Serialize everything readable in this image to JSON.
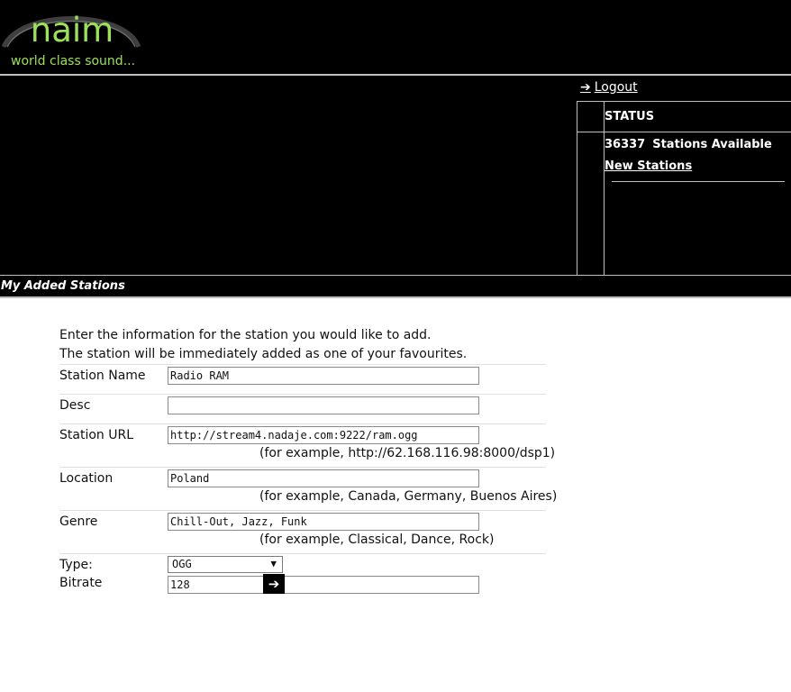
{
  "header": {
    "logo_text": "naim",
    "tagline": "world class sound..."
  },
  "nav": {
    "logout_label": "Logout",
    "logout_icon": "arrow-right-icon"
  },
  "status": {
    "title": "STATUS",
    "station_count": "36337",
    "station_count_suffix": "Stations Available",
    "new_stations_label": "New Stations"
  },
  "section": {
    "title": "My Added Stations"
  },
  "form": {
    "intro_line1": "Enter the information for the station you would like to add.",
    "intro_line2": "The station will be immediately added as one of your favourites.",
    "station_name": {
      "label": "Station Name",
      "value": "Radio RAM"
    },
    "desc": {
      "label": "Desc",
      "value": ""
    },
    "station_url": {
      "label": "Station URL",
      "value": "http://stream4.nadaje.com:9222/ram.ogg",
      "example": "(for example, http://62.168.116.98:8000/dsp1)"
    },
    "location": {
      "label": "Location",
      "value": "Poland",
      "example": "(for example, Canada, Germany, Buenos Aires)"
    },
    "genre": {
      "label": "Genre",
      "value": "Chill-Out, Jazz, Funk",
      "example": "(for example, Classical, Dance, Rock)"
    },
    "type": {
      "label": "Type:",
      "selected": "OGG"
    },
    "bitrate": {
      "label": "Bitrate",
      "value": "128"
    },
    "submit_icon": "arrow-right-icon"
  },
  "colors": {
    "logo_green": "#9be15a",
    "header_bg": "#000000",
    "rule_gray": "#bdbdbd"
  }
}
